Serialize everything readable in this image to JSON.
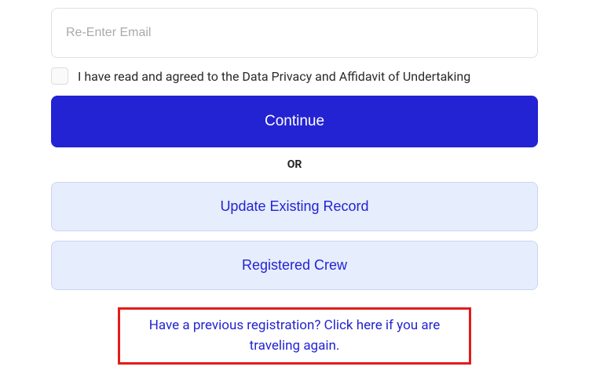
{
  "form": {
    "reenter_email_placeholder": "Re-Enter Email",
    "privacy_label": "I have read and agreed to the Data Privacy and Affidavit of Undertaking",
    "continue_label": "Continue",
    "divider_label": "OR",
    "update_record_label": "Update Existing Record",
    "registered_crew_label": "Registered Crew",
    "previous_registration_link": "Have a previous registration? Click here if you are traveling again."
  }
}
